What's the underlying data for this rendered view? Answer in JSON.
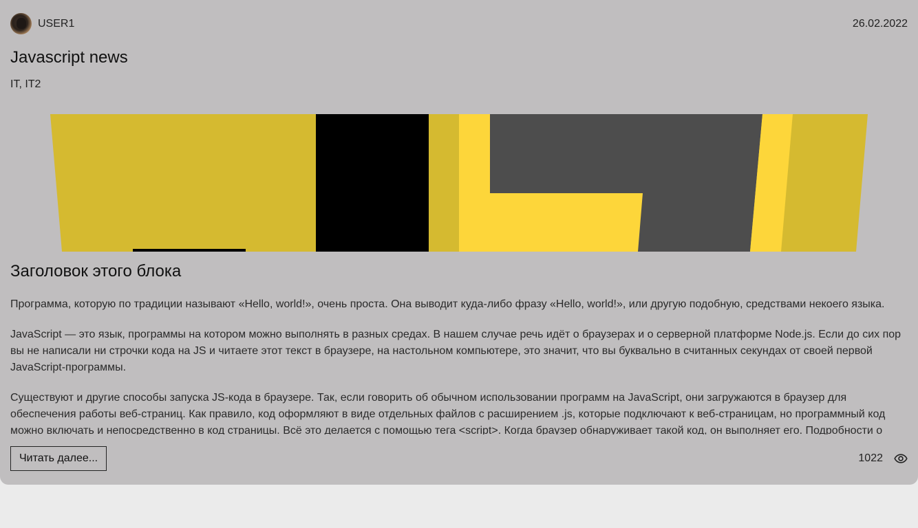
{
  "post": {
    "author": "USER1",
    "date": "26.02.2022",
    "title": "Javascript news",
    "tags": "IT, IT2",
    "subtitle": "Заголовок этого блока",
    "paragraphs": [
      "Программа, которую по традиции называют «Hello, world!», очень проста. Она выводит куда-либо фразу «Hello, world!», или другую подобную, средствами некоего языка.",
      "JavaScript — это язык, программы на котором можно выполнять в разных средах. В нашем случае речь идёт о браузерах и о серверной платформе Node.js. Если до сих пор вы не написали ни строчки кода на JS и читаете этот текст в браузере, на настольном компьютере, это значит, что вы буквально в считанных секундах от своей первой JavaScript-программы.",
      "Существуют и другие способы запуска JS-кода в браузере. Так, если говорить об обычном использовании программ на JavaScript, они загружаются в браузер для обеспечения работы веб-страниц. Как правило, код оформляют в виде отдельных файлов с расширением .js, которые подключают к веб-страницам, но программный код можно включать и непосредственно в код страницы. Всё это делается с помощью тега <script>. Когда браузер обнаруживает такой код, он выполняет его. Подробности о"
    ],
    "read_more_label": "Читать далее...",
    "views": "1022"
  },
  "icons": {
    "avatar": "user-avatar",
    "views": "eye-icon"
  },
  "colors": {
    "card_bg": "#c0bebf",
    "page_bg": "#ebebeb",
    "banner_yellow": "#d5ba30",
    "banner_bright_yellow": "#fdd63a",
    "banner_dark": "#4d4d4d",
    "banner_black": "#000000"
  }
}
